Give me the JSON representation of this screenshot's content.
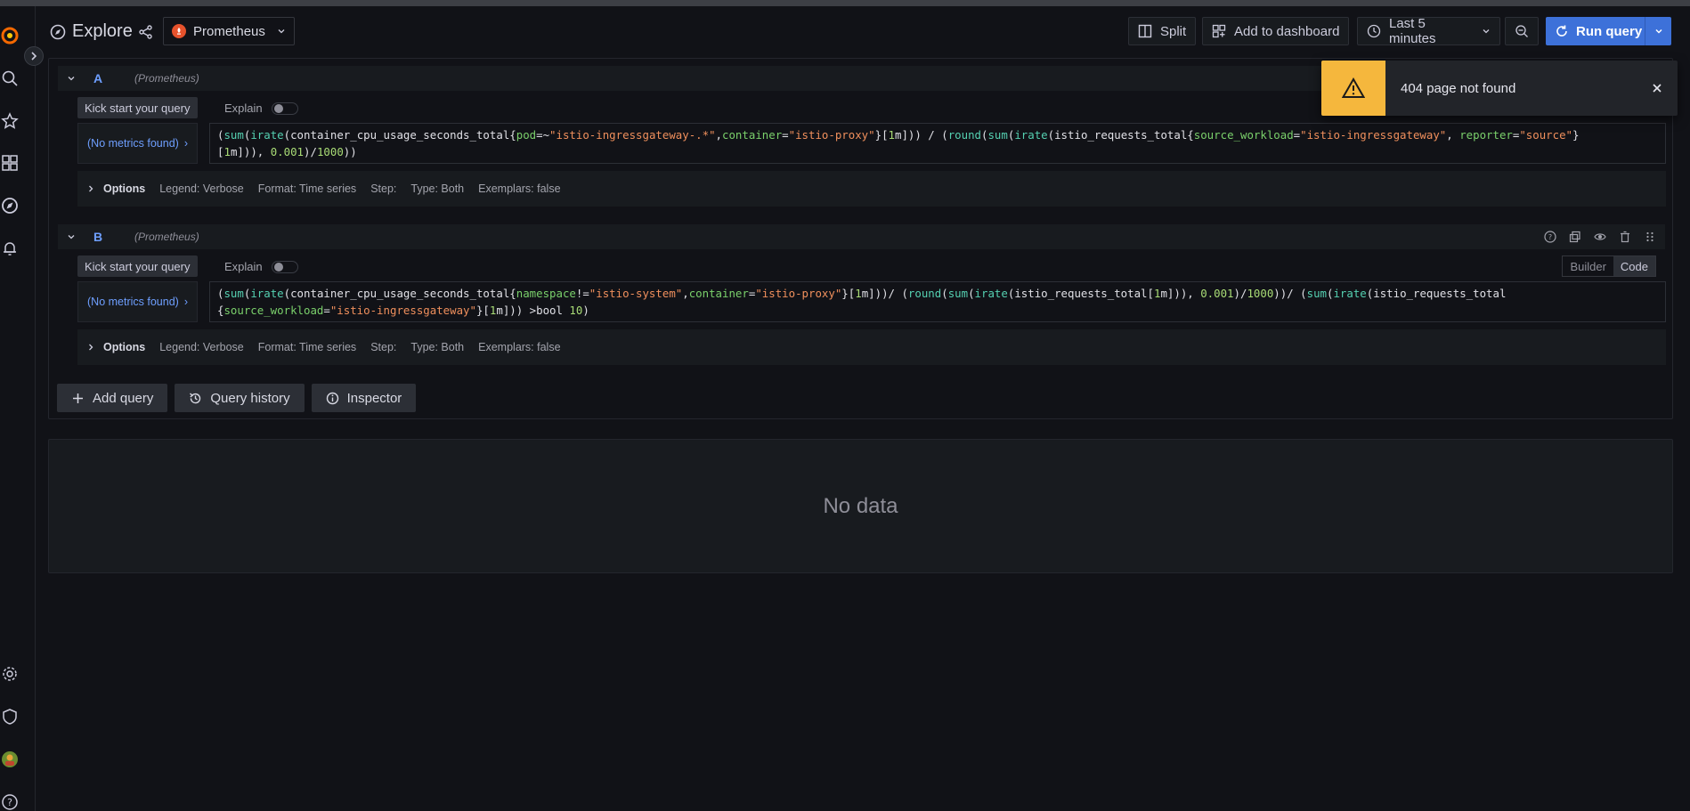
{
  "header": {
    "title": "Explore",
    "datasource": "Prometheus",
    "split_label": "Split",
    "add_to_dashboard_label": "Add to dashboard",
    "time_range_label": "Last 5 minutes",
    "run_query_label": "Run query"
  },
  "toast": {
    "message": "404 page not found",
    "accent_color": "#f5b73d"
  },
  "queries": [
    {
      "ref": "A",
      "datasource": "(Prometheus)",
      "kick_start_label": "Kick start your query",
      "explain_label": "Explain",
      "metrics_button_label": "(No metrics found)",
      "expr_line1": "(sum(irate(container_cpu_usage_seconds_total{pod=~\"istio-ingressgateway-.*\",container=\"istio-proxy\"}[1m])) / (round(sum(irate(istio_requests_total{source_workload=\"istio-ingressgateway\", reporter=\"source\"}",
      "expr_line2": "[1m])), 0.001)/1000))",
      "options": {
        "title": "Options",
        "legend": "Legend: Verbose",
        "format": "Format: Time series",
        "step": "Step:",
        "type": "Type: Both",
        "exemplars": "Exemplars: false"
      }
    },
    {
      "ref": "B",
      "datasource": "(Prometheus)",
      "kick_start_label": "Kick start your query",
      "explain_label": "Explain",
      "metrics_button_label": "(No metrics found)",
      "mode_builder": "Builder",
      "mode_code": "Code",
      "expr_line1": "(sum(irate(container_cpu_usage_seconds_total{namespace!=\"istio-system\",container=\"istio-proxy\"}[1m]))/ (round(sum(irate(istio_requests_total[1m])), 0.001)/1000))/ (sum(irate(istio_requests_total",
      "expr_line2": "{source_workload=\"istio-ingressgateway\"}[1m])) >bool 10)",
      "options": {
        "title": "Options",
        "legend": "Legend: Verbose",
        "format": "Format: Time series",
        "step": "Step:",
        "type": "Type: Both",
        "exemplars": "Exemplars: false"
      }
    }
  ],
  "actions": {
    "add_query": "Add query",
    "query_history": "Query history",
    "inspector": "Inspector"
  },
  "result": {
    "no_data": "No data"
  },
  "icons": [
    "grafana-logo-icon",
    "search-icon",
    "star-icon",
    "dashboards-icon",
    "explore-icon",
    "alert-bell-icon",
    "gear-icon",
    "shield-icon",
    "avatar",
    "help-icon",
    "share-icon",
    "split-icon",
    "dashboard-add-icon",
    "clock-icon",
    "zoom-out-icon",
    "refresh-icon",
    "warning-icon",
    "close-icon"
  ]
}
